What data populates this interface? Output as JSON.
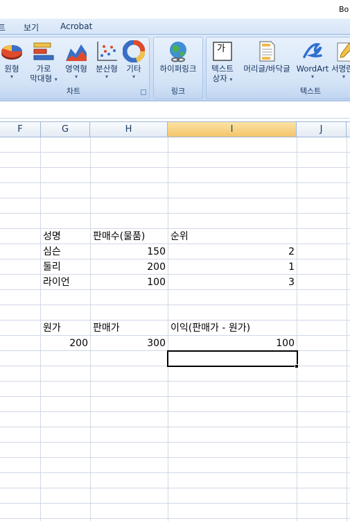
{
  "window": {
    "title_fragment": "Bo"
  },
  "menu": {
    "tab_partial": "트",
    "tab_view": "보기",
    "tab_acrobat": "Acrobat"
  },
  "ribbon": {
    "chart_group": {
      "label": "차트",
      "buttons": [
        {
          "label": "원형",
          "icon": "pie-chart-icon"
        },
        {
          "label1": "가로",
          "label2": "막대형",
          "icon": "bar-chart-icon"
        },
        {
          "label": "영역형",
          "icon": "area-chart-icon"
        },
        {
          "label": "분산형",
          "icon": "scatter-chart-icon"
        },
        {
          "label": "기타",
          "icon": "donut-chart-icon"
        }
      ]
    },
    "link_group": {
      "label": "링크",
      "hyperlink_label": "하이퍼링크"
    },
    "text_group": {
      "label": "텍스트",
      "textbox_label1": "텍스트",
      "textbox_label2": "상자",
      "textbox_icon_text": "가",
      "header_footer_label": "머리글/바닥글",
      "wordart_label": "WordArt",
      "signature_label": "서명란"
    }
  },
  "columns": [
    "F",
    "G",
    "H",
    "I",
    "J"
  ],
  "selected_column": "I",
  "cells": {
    "r7": {
      "g": "성명",
      "h": "판매수(물품)",
      "i": "순위"
    },
    "r8": {
      "g": "심슨",
      "h": "150",
      "i": "2"
    },
    "r9": {
      "g": "둘리",
      "h": "200",
      "i": "1"
    },
    "r10": {
      "g": "라이언",
      "h": "100",
      "i": "3"
    },
    "r13": {
      "g": "원가",
      "h": "판매가",
      "i": "이익(판매가 - 원가)"
    },
    "r14": {
      "g": "200",
      "h": "300",
      "i": "100"
    }
  },
  "colors": {
    "ribbon_text": "#15325e",
    "selected_header": "#f4c56a",
    "grid_line": "#d0d7e5"
  }
}
